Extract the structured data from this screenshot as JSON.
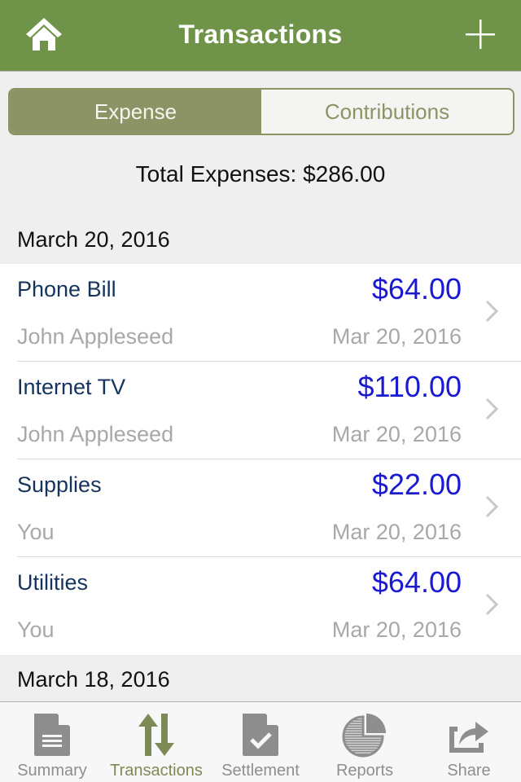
{
  "navbar": {
    "title": "Transactions",
    "left_icon": "home-icon",
    "right_icon": "plus-icon",
    "color": "#6f9349"
  },
  "segment": {
    "options": [
      {
        "label": "Expense",
        "selected": true
      },
      {
        "label": "Contributions",
        "selected": false
      }
    ],
    "accent": "#8c9465"
  },
  "total": {
    "text": "Total Expenses: $286.00"
  },
  "sections": [
    {
      "header": "March 20, 2016",
      "items": [
        {
          "title": "Phone Bill",
          "amount": "$64.00",
          "person": "John Appleseed",
          "date": "Mar 20, 2016"
        },
        {
          "title": "Internet TV",
          "amount": "$110.00",
          "person": "John Appleseed",
          "date": "Mar 20, 2016"
        },
        {
          "title": "Supplies",
          "amount": "$22.00",
          "person": "You",
          "date": "Mar 20, 2016"
        },
        {
          "title": "Utilities",
          "amount": "$64.00",
          "person": "You",
          "date": "Mar 20, 2016"
        }
      ]
    },
    {
      "header": "March 18, 2016",
      "items": []
    }
  ],
  "colors": {
    "amount": "#1a1ad0",
    "title": "#14345e",
    "secondary": "#a8a8a8"
  },
  "tabbar": {
    "items": [
      {
        "label": "Summary",
        "icon": "document-icon",
        "active": false
      },
      {
        "label": "Transactions",
        "icon": "transfer-arrows-icon",
        "active": true
      },
      {
        "label": "Settlement",
        "icon": "checked-document-icon",
        "active": false
      },
      {
        "label": "Reports",
        "icon": "pie-chart-icon",
        "active": false
      },
      {
        "label": "Share",
        "icon": "share-icon",
        "active": false
      }
    ],
    "active_color": "#7d8a55",
    "inactive_color": "#8e8e8e"
  }
}
